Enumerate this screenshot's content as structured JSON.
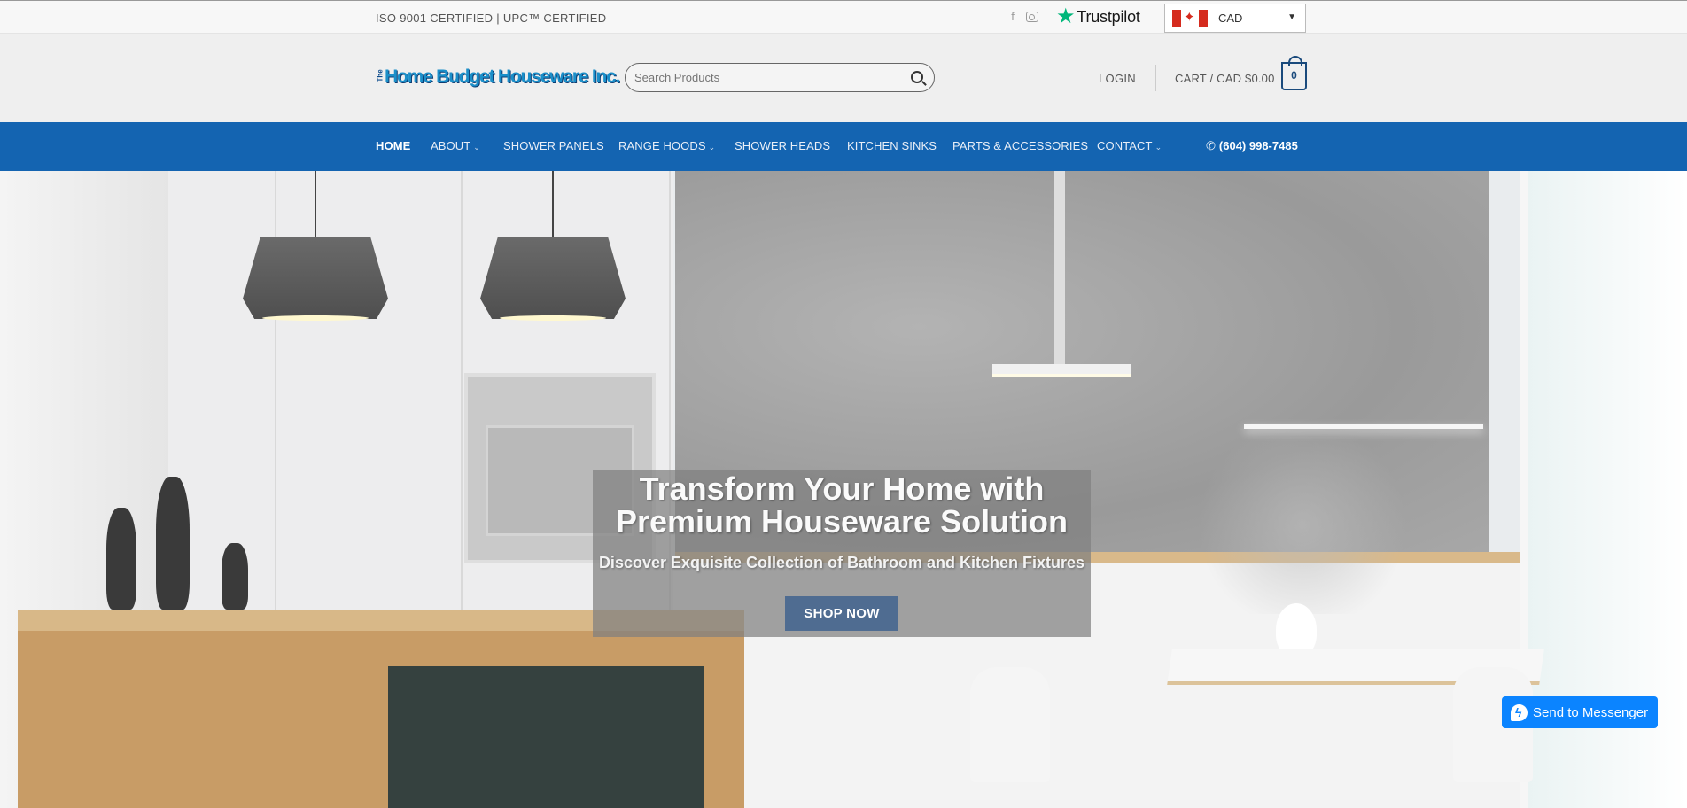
{
  "topbar": {
    "certifications": "ISO 9001 CERTIFIED | UPC™ CERTIFIED",
    "social": [
      "facebook-icon",
      "instagram-icon"
    ],
    "trustpilot": "Trustpilot",
    "currency": {
      "selected": "CAD",
      "flag": "canada-flag-icon"
    }
  },
  "header": {
    "logo": {
      "prefix": "The",
      "name": "Home Budget Houseware Inc."
    },
    "search": {
      "placeholder": "Search Products"
    },
    "login": "LOGIN",
    "cart": {
      "label": "CART / CAD $0.00",
      "count": "0"
    }
  },
  "nav": {
    "items": [
      {
        "label": "HOME",
        "active": true
      },
      {
        "label": "ABOUT",
        "dropdown": true
      },
      {
        "label": "SHOWER PANELS"
      },
      {
        "label": "RANGE HOODS",
        "dropdown": true
      },
      {
        "label": "SHOWER HEADS"
      },
      {
        "label": "KITCHEN SINKS"
      },
      {
        "label": "PARTS & ACCESSORIES"
      },
      {
        "label": "CONTACT",
        "dropdown": true
      }
    ],
    "phone": "(604) 998-7485",
    "chevron": "⌄"
  },
  "hero": {
    "title_line1": "Transform Your Home with",
    "title_line2": "Premium Houseware Solution",
    "subtitle": "Discover Exquisite Collection of Bathroom and Kitchen Fixtures",
    "cta": "SHOP NOW"
  },
  "messenger": {
    "label": "Send to Messenger"
  },
  "colors": {
    "nav_bg": "#1464b1",
    "cta_bg": "#4f6c91",
    "messenger_bg": "#0b84ff",
    "trustpilot_star": "#00b67a"
  }
}
